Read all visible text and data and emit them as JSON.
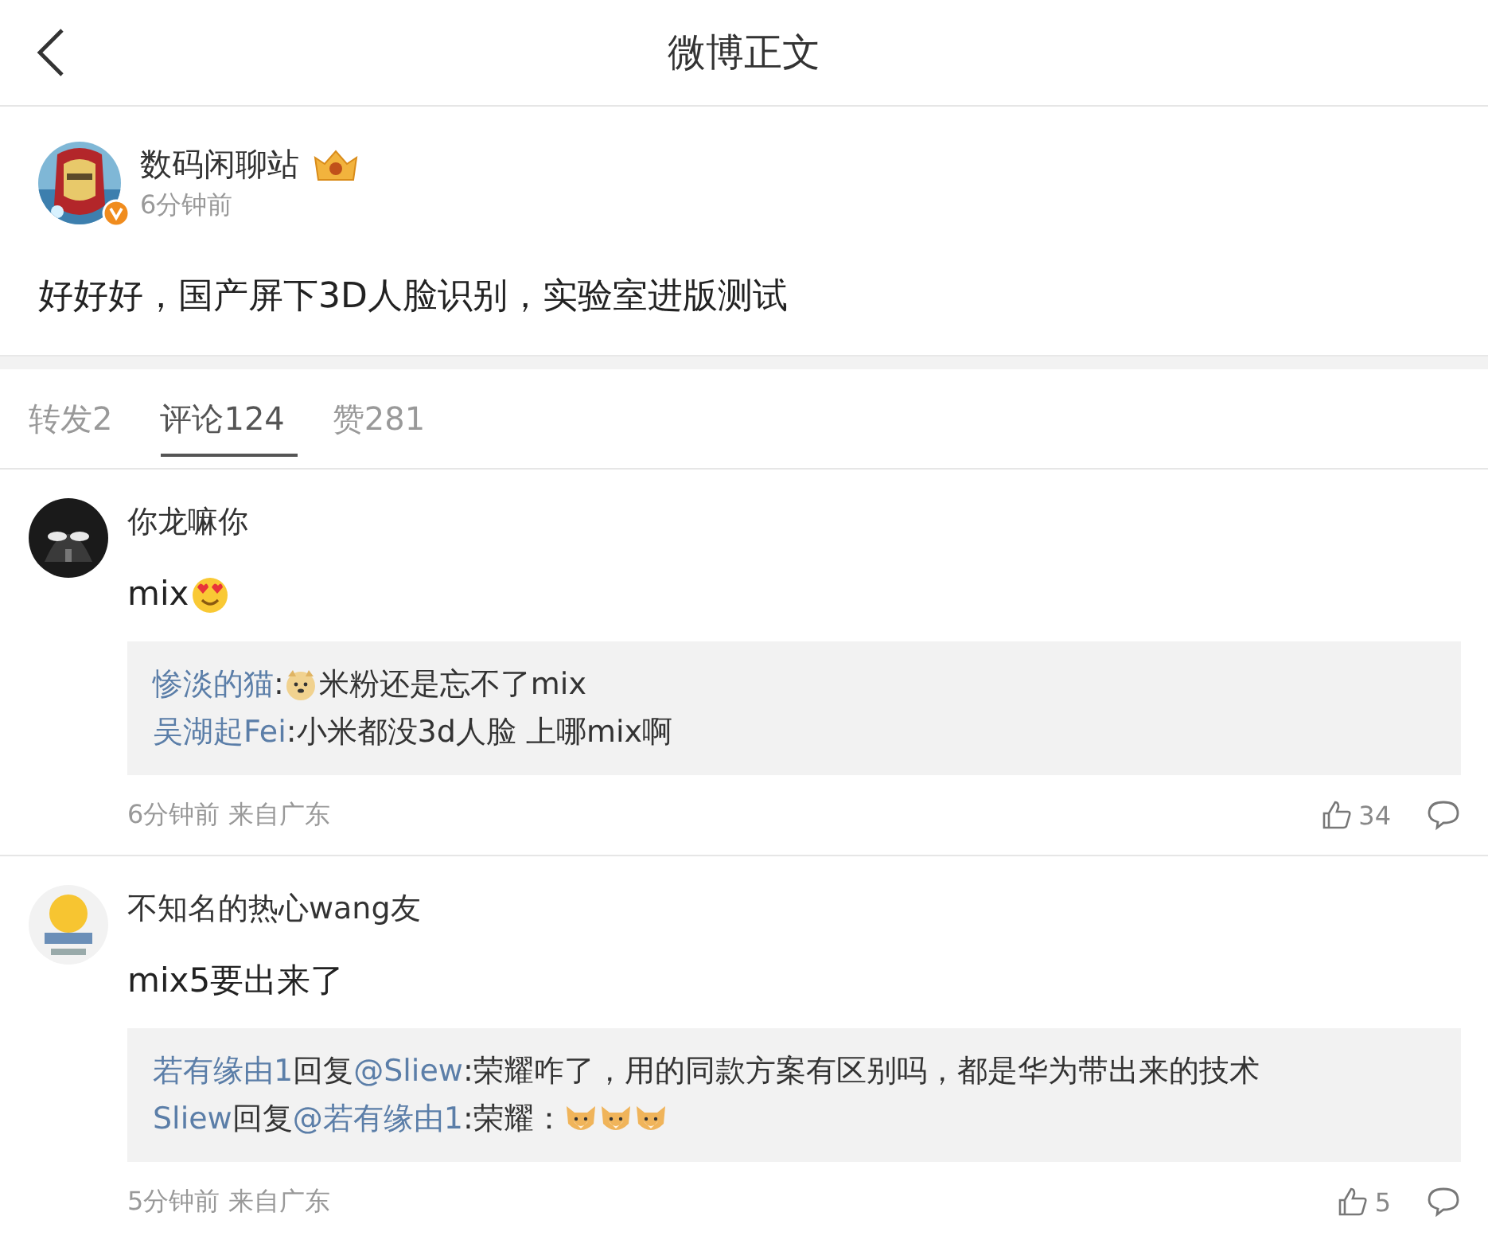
{
  "header": {
    "title": "微博正文"
  },
  "post": {
    "author": "数码闲聊站",
    "verified": true,
    "time": "6分钟前",
    "text": "好好好，国产屏下3D人脸识别，实验室进版测试"
  },
  "tabs": [
    {
      "label": "转发2",
      "selected": false
    },
    {
      "label": "评论124",
      "selected": true
    },
    {
      "label": "赞281",
      "selected": false
    }
  ],
  "comments": [
    {
      "author": "你龙嘛你",
      "kind": "dark",
      "body": [
        {
          "kind": "text",
          "text": "mix"
        },
        {
          "kind": "heart_eyes"
        }
      ],
      "replies": [
        [
          {
            "kind": "link",
            "text": "惨淡的猫"
          },
          {
            "kind": "text",
            "text": ":"
          },
          {
            "kind": "doge"
          },
          {
            "kind": "text",
            "text": "米粉还是忘不了mix"
          }
        ],
        [
          {
            "kind": "link",
            "text": "吴湖起Fei"
          },
          {
            "kind": "text",
            "text": ":小米都没3d人脸 上哪mix啊"
          }
        ]
      ],
      "meta": "6分钟前 来自广东",
      "likes": "34"
    },
    {
      "author": "不知名的热心wang友",
      "kind": "light",
      "body": [
        {
          "kind": "text",
          "text": "mix5要出来了"
        }
      ],
      "replies": [
        [
          {
            "kind": "link",
            "text": "若有缘由1"
          },
          {
            "kind": "text",
            "text": "回复"
          },
          {
            "kind": "link",
            "text": "@Sliew"
          },
          {
            "kind": "text",
            "text": ":荣耀咋了，用的同款方案有区别吗，都是华为带出来的技术"
          }
        ],
        [
          {
            "kind": "link",
            "text": "Sliew"
          },
          {
            "kind": "text",
            "text": "回复"
          },
          {
            "kind": "link",
            "text": "@若有缘由1"
          },
          {
            "kind": "text",
            "text": ":荣耀："
          },
          {
            "kind": "dog"
          },
          {
            "kind": "dog"
          },
          {
            "kind": "dog"
          }
        ]
      ],
      "meta": "5分钟前 来自广东",
      "likes": "5"
    }
  ]
}
